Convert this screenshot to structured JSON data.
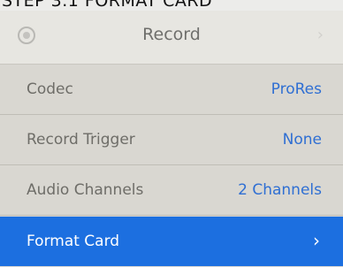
{
  "caption": "STEP 3.1 FORMAT CARD",
  "header": {
    "title": "Record",
    "icon": "record-icon",
    "chevron": "chevron-right-icon"
  },
  "rows": [
    {
      "label": "Codec",
      "value": "ProRes"
    },
    {
      "label": "Record Trigger",
      "value": "None"
    },
    {
      "label": "Audio Channels",
      "value": "2 Channels"
    },
    {
      "label": "Format Card",
      "chevron": "chevron-right-icon"
    }
  ],
  "colors": {
    "accent": "#1c6fe0",
    "value_text": "#2f6fd3"
  }
}
